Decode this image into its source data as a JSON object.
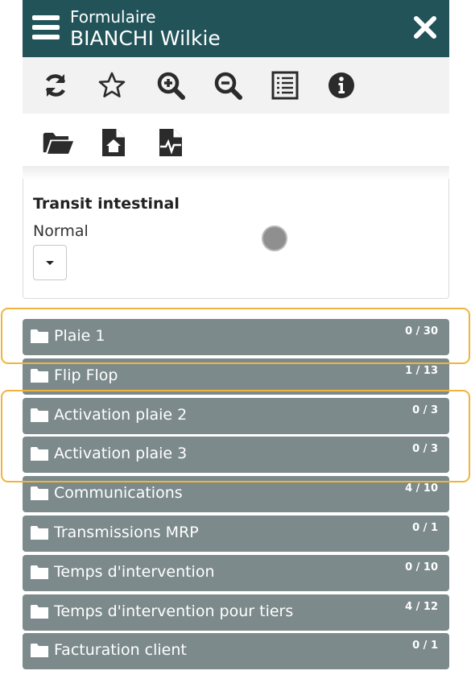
{
  "header": {
    "subtitle": "Formulaire",
    "title": "BIANCHI Wilkie"
  },
  "toolbar": {
    "row1": [
      "refresh-icon",
      "star-icon",
      "zoom-in-icon",
      "zoom-out-icon",
      "list-icon",
      "info-icon"
    ],
    "row2": [
      "folder-open-icon",
      "file-home-icon",
      "file-pulse-icon"
    ]
  },
  "field": {
    "label": "Transit intestinal",
    "value": "Normal"
  },
  "folders": [
    {
      "label": "Plaie 1",
      "count": "0 / 30"
    },
    {
      "label": "Flip Flop",
      "count": "1 / 13"
    },
    {
      "label": "Activation plaie 2",
      "count": "0 / 3"
    },
    {
      "label": "Activation plaie 3",
      "count": "0 / 3"
    },
    {
      "label": "Communications",
      "count": "4 / 10"
    },
    {
      "label": "Transmissions MRP",
      "count": "0 / 1"
    },
    {
      "label": "Temps d'intervention",
      "count": "0 / 10"
    },
    {
      "label": "Temps d'intervention pour tiers",
      "count": "4 / 12"
    },
    {
      "label": "Facturation client",
      "count": "0 / 1"
    }
  ],
  "colors": {
    "header": "#215359",
    "folder": "#7c8a8c",
    "highlight": "#f0b43c"
  }
}
